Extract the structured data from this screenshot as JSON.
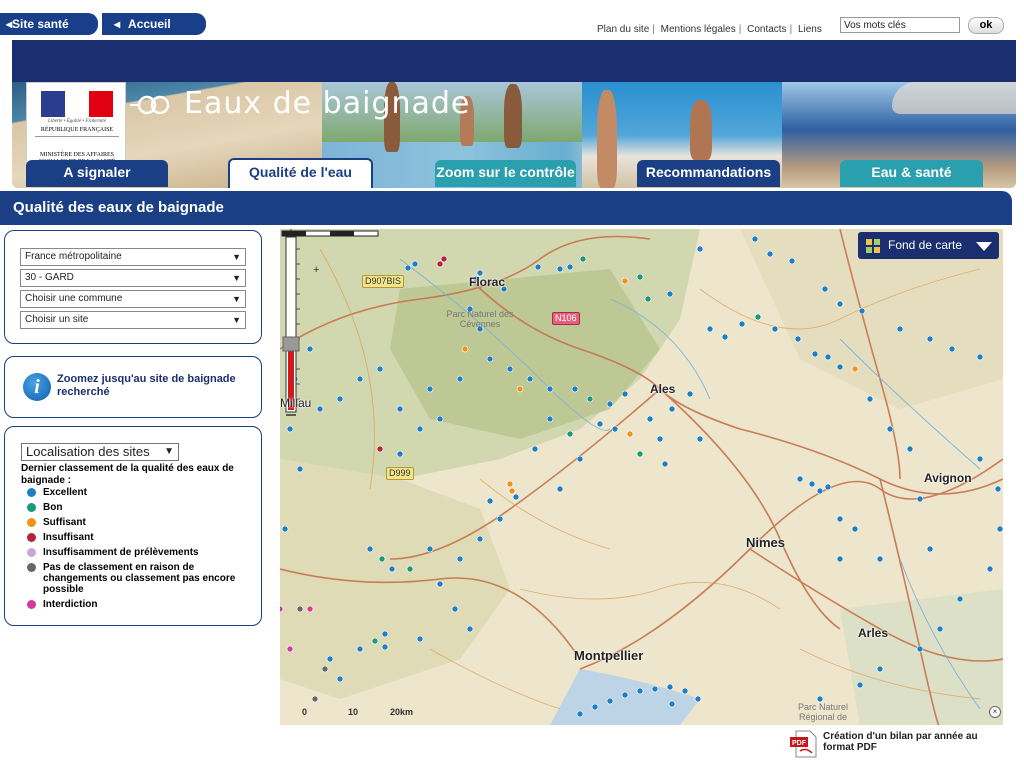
{
  "nav": {
    "site_sante": "Site santé",
    "accueil": "Accueil"
  },
  "toplinks": [
    "Plan du site",
    "Mentions légales",
    "Contacts",
    "Liens"
  ],
  "search": {
    "value": "Vos mots clés",
    "button": "ok"
  },
  "header": {
    "title": "Eaux de baignade",
    "motto": "Liberté • Égalité • Fraternité",
    "republic": "RÉPUBLIQUE FRANÇAISE",
    "ministry": "MINISTÈRE DES AFFAIRES SOCIALES ET DE LA SANTÉ"
  },
  "tabs": [
    {
      "label": "A signaler",
      "active": false
    },
    {
      "label": "Qualité de l'eau",
      "active": true
    },
    {
      "label": "Zoom sur le contrôle",
      "active": false
    },
    {
      "label": "Recommandations",
      "active": false
    },
    {
      "label": "Eau & santé",
      "active": false
    }
  ],
  "section": {
    "title": "Qualité des eaux de baignade"
  },
  "filters": {
    "region": "France métropolitaine",
    "departement": "30 - GARD",
    "commune": "Choisir une commune",
    "site": "Choisir un site"
  },
  "info": {
    "text": "Zoomez jusqu'au site de baignade recherché"
  },
  "legend": {
    "select": "Localisation des sites",
    "title": "Dernier classement de la qualité des eaux de baignade :",
    "items": [
      {
        "label": "Excellent",
        "color": "#1f7fc4"
      },
      {
        "label": "Bon",
        "color": "#1a9a7a"
      },
      {
        "label": "Suffisant",
        "color": "#f0921c"
      },
      {
        "label": "Insuffisant",
        "color": "#b5243a"
      },
      {
        "label": "Insuffisamment de prélèvements",
        "color": "#c9a6d6"
      },
      {
        "label": "Pas de classement en raison de changements ou classement pas encore possible",
        "color": "#666666"
      },
      {
        "label": "Interdiction",
        "color": "#d43a9a"
      }
    ]
  },
  "map": {
    "basemap_button": "Fond de carte",
    "cities": [
      "Florac",
      "Ales",
      "Millau",
      "Nimes",
      "Avignon",
      "Montpellier",
      "Arles"
    ],
    "roads": [
      "D907BIS",
      "N106",
      "D999"
    ],
    "parcs": [
      "Parc Naturel des Cévennes",
      "Parc Naturel Régional de"
    ],
    "scale": [
      "0",
      "10",
      "20km"
    ]
  },
  "pdf": {
    "text": "Création d'un bilan par année au format PDF"
  }
}
